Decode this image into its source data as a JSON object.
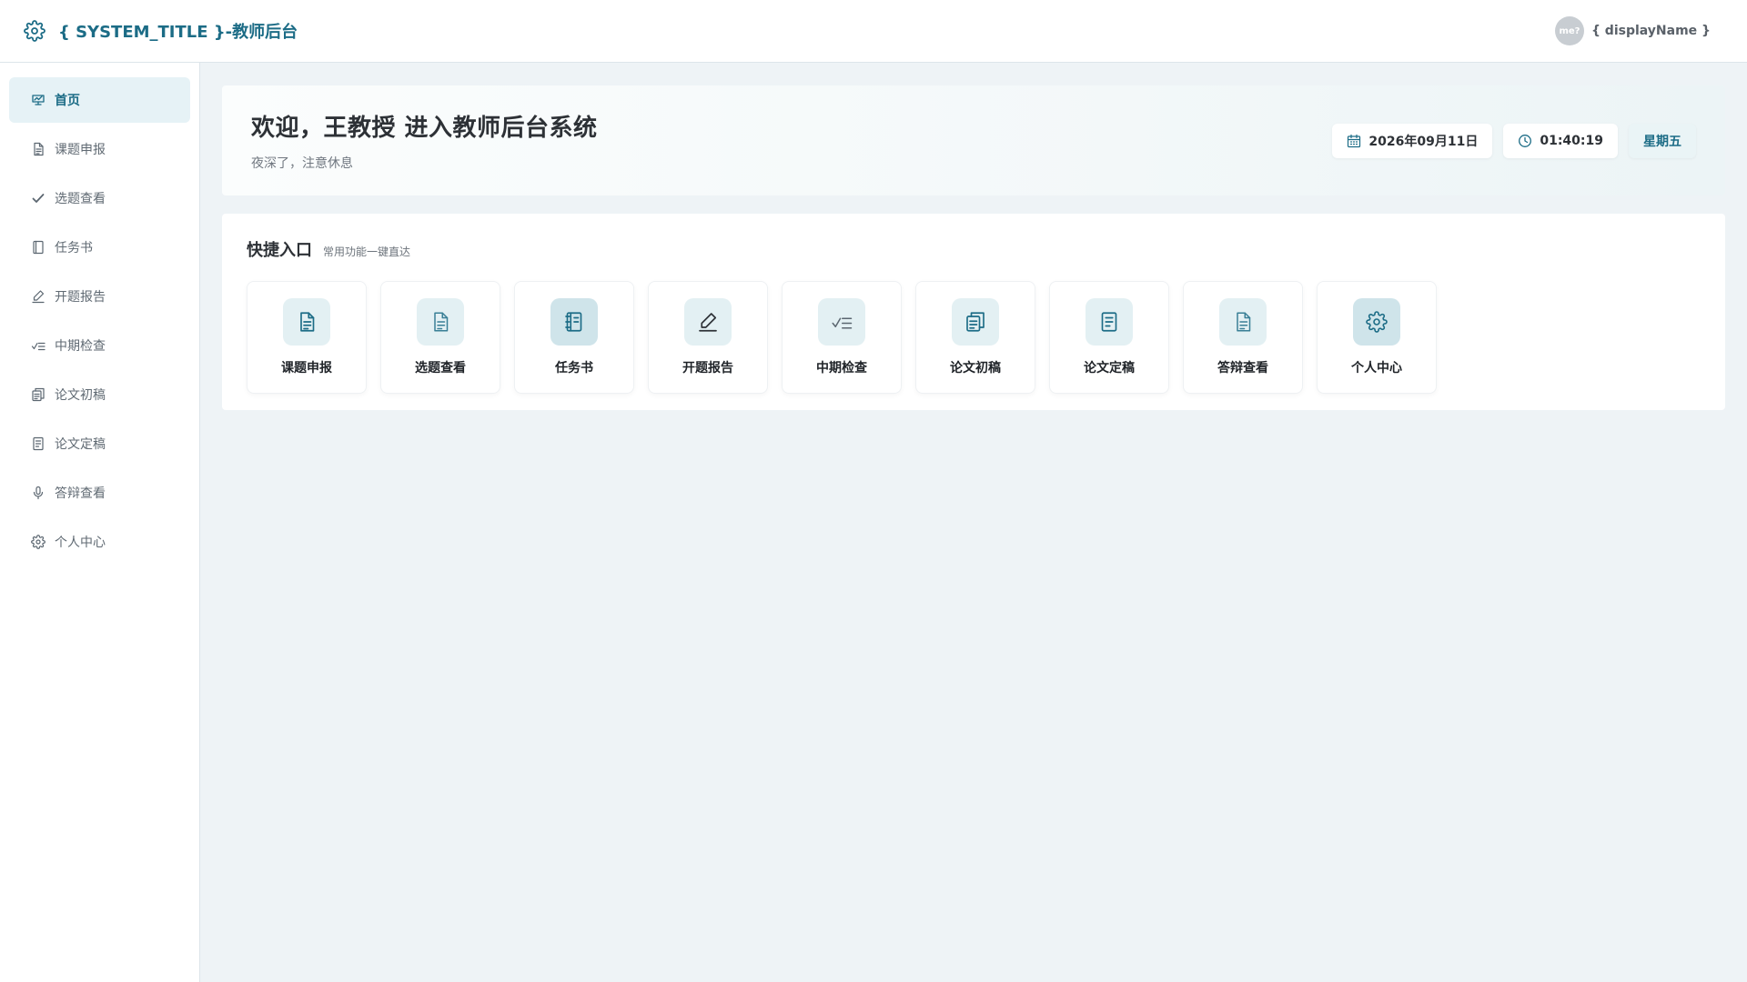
{
  "header": {
    "title": "{ SYSTEM_TITLE }-教师后台",
    "avatar_text": "me?",
    "user_name": "{ displayName }"
  },
  "sidebar": {
    "items": [
      {
        "label": "首页",
        "icon": "home-icon",
        "active": true
      },
      {
        "label": "课题申报",
        "icon": "document-icon"
      },
      {
        "label": "选题查看",
        "icon": "check-icon"
      },
      {
        "label": "任务书",
        "icon": "book-icon"
      },
      {
        "label": "开题报告",
        "icon": "pen-icon"
      },
      {
        "label": "中期检查",
        "icon": "checklist-icon"
      },
      {
        "label": "论文初稿",
        "icon": "copy-icon"
      },
      {
        "label": "论文定稿",
        "icon": "file-icon"
      },
      {
        "label": "答辩查看",
        "icon": "microphone-icon"
      },
      {
        "label": "个人中心",
        "icon": "gear-icon"
      }
    ]
  },
  "welcome": {
    "title": "欢迎，王教授 进入教师后台系统",
    "subtitle": "夜深了，注意休息",
    "date": "2026年09月11日",
    "time": "01:40:19",
    "weekday": "星期五"
  },
  "quick": {
    "title": "快捷入口",
    "subtitle": "常用功能一键直达",
    "cards": [
      {
        "label": "课题申报",
        "icon": "document-icon"
      },
      {
        "label": "选题查看",
        "icon": "document-icon"
      },
      {
        "label": "任务书",
        "icon": "book-icon"
      },
      {
        "label": "开题报告",
        "icon": "pen-icon"
      },
      {
        "label": "中期检查",
        "icon": "checklist-icon"
      },
      {
        "label": "论文初稿",
        "icon": "copy-icon"
      },
      {
        "label": "论文定稿",
        "icon": "file-icon"
      },
      {
        "label": "答辩查看",
        "icon": "document-icon"
      },
      {
        "label": "个人中心",
        "icon": "gear-icon"
      }
    ]
  },
  "colors": {
    "accent": "#1c6c86",
    "background": "#eef3f6",
    "active_bg": "#e6f2f6"
  }
}
